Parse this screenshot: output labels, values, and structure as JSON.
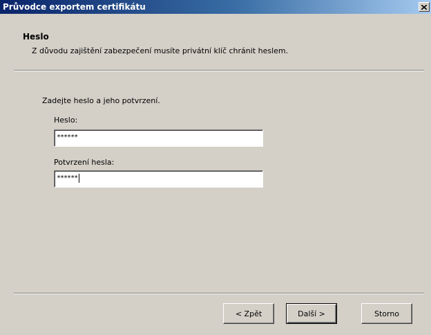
{
  "window": {
    "title": "Průvodce exportem certifikátu",
    "close_label": "×"
  },
  "header": {
    "title": "Heslo",
    "subtitle": "Z důvodu zajištění zabezpečení musíte privátní klíč chránit heslem."
  },
  "body": {
    "instruction": "Zadejte heslo a jeho potvrzení.",
    "password": {
      "label": "Heslo:",
      "value": "******"
    },
    "confirm": {
      "label": "Potvrzení hesla:",
      "value": "******"
    }
  },
  "buttons": {
    "back": "< Zpět",
    "next": "Další >",
    "cancel": "Storno"
  },
  "colors": {
    "titlebar_start": "#0a246a",
    "titlebar_end": "#a6caf0",
    "dialog_bg": "#d4d0c8"
  }
}
